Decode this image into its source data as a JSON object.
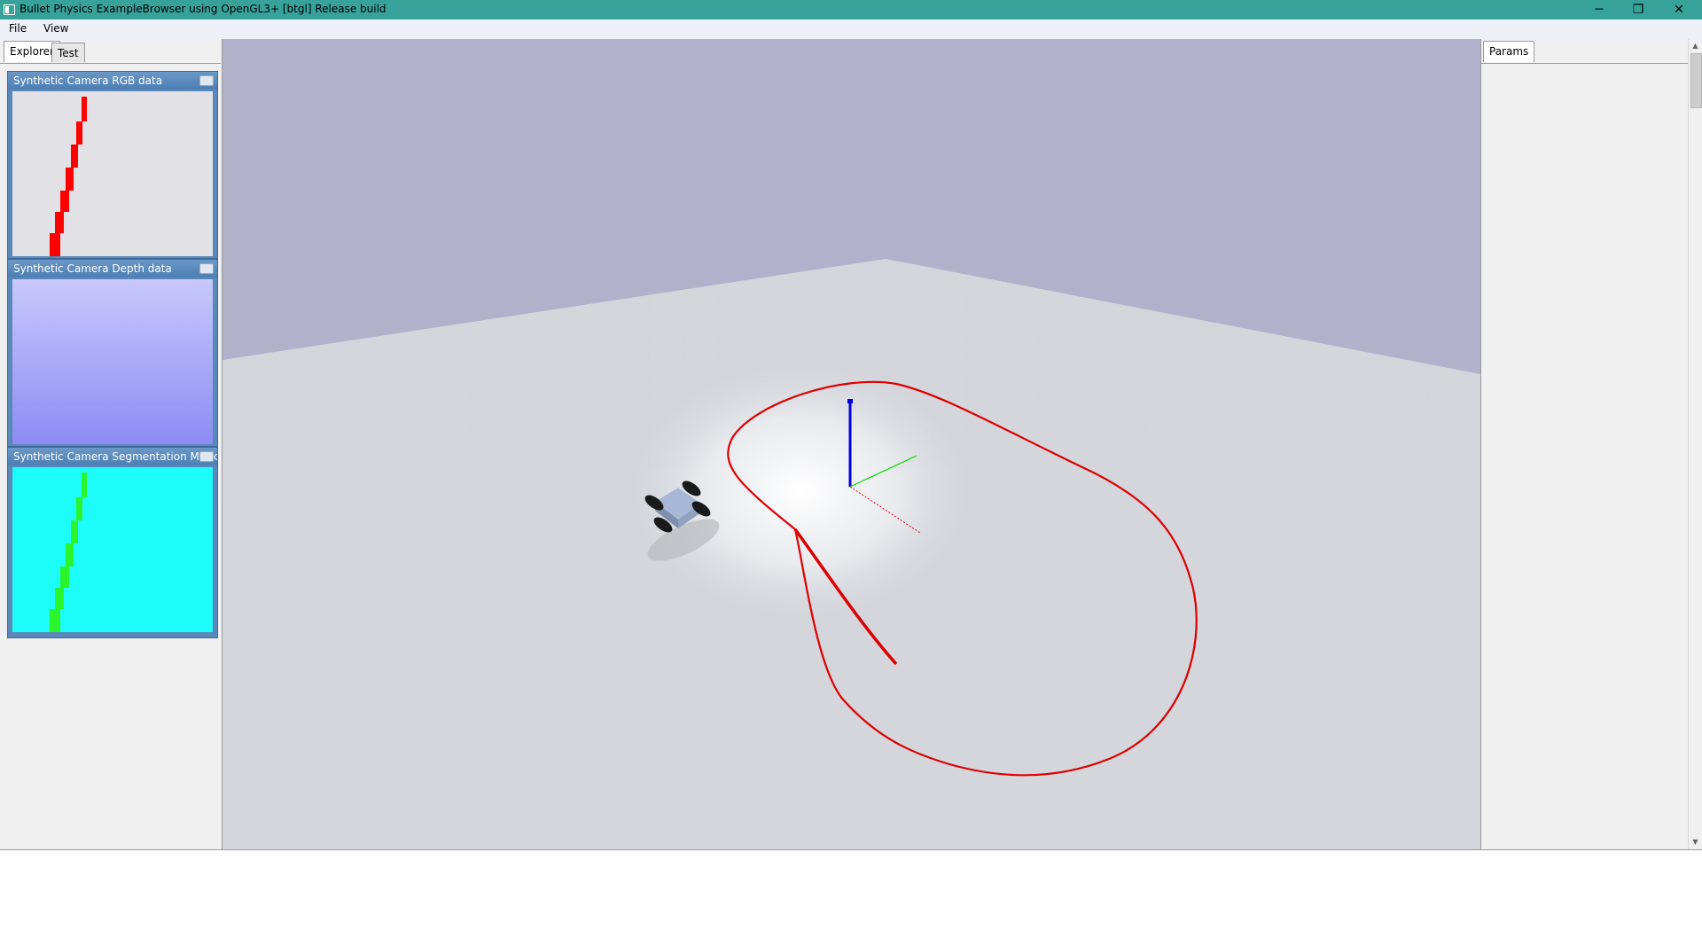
{
  "window": {
    "title": "Bullet Physics ExampleBrowser using OpenGL3+ [btgl] Release build",
    "minimize_glyph": "─",
    "restore_glyph": "❐",
    "close_glyph": "✕"
  },
  "menu": {
    "file": "File",
    "view": "View"
  },
  "left_tabs": {
    "explorer": "Explorer",
    "test": "Test"
  },
  "camera_windows": [
    {
      "title": "Synthetic Camera RGB data"
    },
    {
      "title": "Synthetic Camera Depth data"
    },
    {
      "title": "Synthetic Camera Segmentation Mask"
    }
  ],
  "right_tabs": {
    "params": "Params"
  },
  "colors": {
    "titlebar": "#37a29a",
    "sky": "#b1b1cb",
    "floor": "#d4d6dc",
    "track": "#dd0000",
    "rgb_bg": "#e2e2e6",
    "depth_top": "#c8c8fc",
    "depth_bottom": "#8c8cf4",
    "seg_bg": "#1cfcf8",
    "seg_fg": "#2cf42c"
  }
}
